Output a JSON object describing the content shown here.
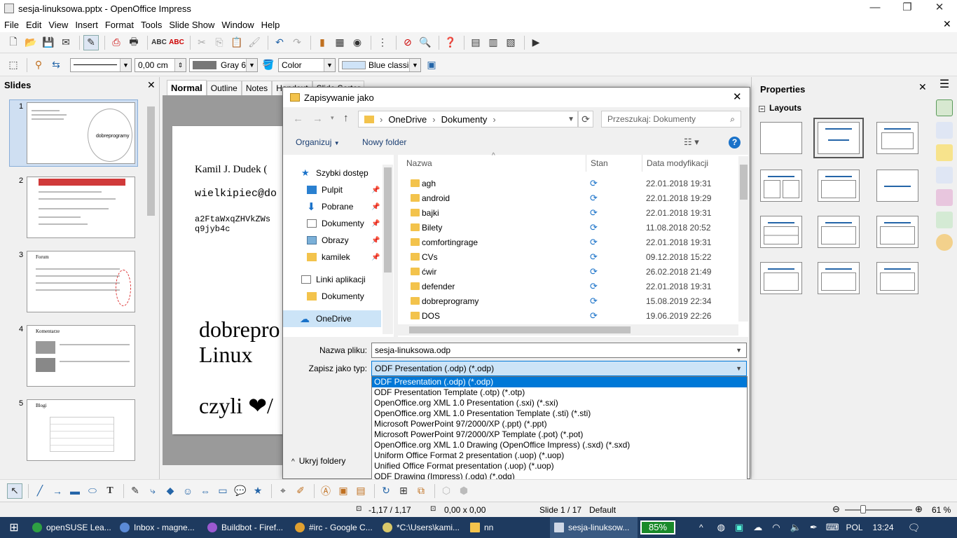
{
  "window": {
    "title": "sesja-linuksowa.pptx - OpenOffice Impress"
  },
  "menu": [
    "File",
    "Edit",
    "View",
    "Insert",
    "Format",
    "Tools",
    "Slide Show",
    "Window",
    "Help"
  ],
  "toolbar2": {
    "line_width": "0,00 cm",
    "color_name": "Gray 6",
    "area_mode": "Color",
    "area_value": "Blue classic"
  },
  "slides_panel": {
    "title": "Slides",
    "thumbs": [
      {
        "num": "1",
        "text": "dobreprogramy"
      },
      {
        "num": "2",
        "text": ""
      },
      {
        "num": "3",
        "text": "Forum"
      },
      {
        "num": "4",
        "text": "Komentarze"
      },
      {
        "num": "5",
        "text": "Blogi"
      }
    ]
  },
  "view_tabs": [
    "Normal",
    "Outline",
    "Notes",
    "Handout",
    "Slide Sorter"
  ],
  "slide": {
    "line1": "Kamil J. Dudek (",
    "line2": "wielkipiec@do",
    "line3": "a2FtaWxqZHVkZWs",
    "line4": "q9jyb4c",
    "big1": "dobrepro",
    "big2": "Linux",
    "big3": "czyli ❤/"
  },
  "properties": {
    "title": "Properties",
    "section": "Layouts"
  },
  "dialog": {
    "title": "Zapisywanie jako",
    "breadcrumb": [
      "OneDrive",
      "Dokumenty"
    ],
    "search_placeholder": "Przeszukaj: Dokumenty",
    "organize": "Organizuj",
    "new_folder": "Nowy folder",
    "nav": [
      {
        "label": "Szybki dostęp",
        "pinned": false
      },
      {
        "label": "Pulpit",
        "pinned": true
      },
      {
        "label": "Pobrane",
        "pinned": true
      },
      {
        "label": "Dokumenty",
        "pinned": true
      },
      {
        "label": "Obrazy",
        "pinned": true
      },
      {
        "label": "kamilek",
        "pinned": true
      },
      {
        "label": "Linki aplikacji",
        "pinned": false
      },
      {
        "label": "Dokumenty",
        "pinned": false
      },
      {
        "label": "OneDrive",
        "pinned": false
      }
    ],
    "columns": {
      "name": "Nazwa",
      "status": "Stan",
      "modified": "Data modyfikacji"
    },
    "files": [
      {
        "name": "agh",
        "date": "22.01.2018 19:31"
      },
      {
        "name": "android",
        "date": "22.01.2018 19:29"
      },
      {
        "name": "bajki",
        "date": "22.01.2018 19:31"
      },
      {
        "name": "Bilety",
        "date": "11.08.2018 20:52"
      },
      {
        "name": "comfortingrage",
        "date": "22.01.2018 19:31"
      },
      {
        "name": "CVs",
        "date": "09.12.2018 15:22"
      },
      {
        "name": "ćwir",
        "date": "26.02.2018 21:49"
      },
      {
        "name": "defender",
        "date": "22.01.2018 19:31"
      },
      {
        "name": "dobreprogramy",
        "date": "15.08.2019 22:34"
      },
      {
        "name": "DOS",
        "date": "19.06.2019 22:26"
      }
    ],
    "filename_label": "Nazwa pliku:",
    "filename_value": "sesja-linuksowa.odp",
    "type_label": "Zapisz jako typ:",
    "type_value": "ODF Presentation (.odp) (*.odp)",
    "type_options": [
      "ODF Presentation (.odp) (*.odp)",
      "ODF Presentation Template (.otp) (*.otp)",
      "OpenOffice.org XML 1.0 Presentation (.sxi) (*.sxi)",
      "OpenOffice.org XML 1.0 Presentation Template (.sti) (*.sti)",
      "Microsoft PowerPoint 97/2000/XP (.ppt) (*.ppt)",
      "Microsoft PowerPoint 97/2000/XP Template (.pot) (*.pot)",
      "OpenOffice.org XML 1.0 Drawing (OpenOffice Impress) (.sxd) (*.sxd)",
      "Uniform Office Format 2 presentation (.uop) (*.uop)",
      "Unified Office Format presentation (.uop) (*.uop)",
      "ODF Drawing (Impress) (.odg) (*.odg)"
    ],
    "hide_folders": "Ukryj foldery"
  },
  "status": {
    "position": "-1,17 / 1,17",
    "size": "0,00 x 0,00",
    "slide": "Slide 1 / 17",
    "layout": "Default",
    "zoom": "61 %"
  },
  "taskbar": {
    "tasks": [
      {
        "label": "openSUSE Lea...",
        "color": "#2ea043"
      },
      {
        "label": "Inbox - magne...",
        "color": "#5b8ad6"
      },
      {
        "label": "Buildbot - Firef...",
        "color": "#9b59d0"
      },
      {
        "label": "#irc - Google C...",
        "color": "#e0a030"
      },
      {
        "label": "*C:\\Users\\kami...",
        "color": "#d9c86a"
      },
      {
        "label": "nn",
        "color": "#f3c34c"
      },
      {
        "label": "sesja-linuksow...",
        "color": "#cfd8e6"
      }
    ],
    "battery": "85%",
    "lang": "POL",
    "time": "13:24"
  }
}
